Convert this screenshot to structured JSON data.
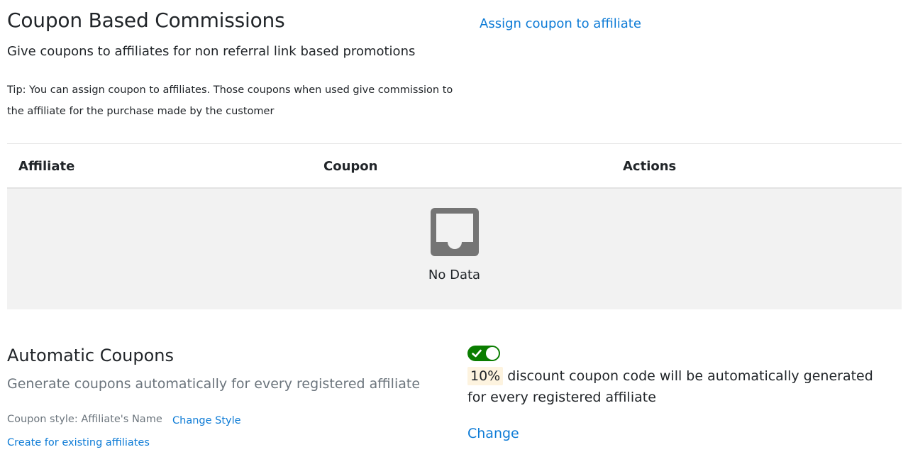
{
  "header": {
    "title": "Coupon Based Commissions",
    "subtitle": "Give coupons to affiliates for non referral link based promotions",
    "tip": "Tip: You can assign coupon to affiliates. Those coupons when used give commission to the affiliate for the purchase made by the customer",
    "assign_link": "Assign coupon to affiliate"
  },
  "table": {
    "columns": [
      "Affiliate",
      "Coupon",
      "Actions"
    ],
    "empty_icon": "inbox-icon",
    "empty_text": "No Data"
  },
  "auto_coupons": {
    "title": "Automatic Coupons",
    "subtitle": "Generate coupons automatically for every registered affiliate",
    "style_label": "Coupon style: Affiliate's Name",
    "change_style": "Change Style",
    "create_existing": "Create for existing affiliates",
    "toggle_enabled": true,
    "toggle_color": "#0a7d00",
    "discount": "10%",
    "description": " discount coupon code will be automatically generated for every registered affiliate",
    "change_link": "Change"
  },
  "colors": {
    "link": "#0d7bd6",
    "muted": "#6c757d",
    "empty_bg": "#f2f2f2",
    "highlight": "#fdf3df"
  }
}
